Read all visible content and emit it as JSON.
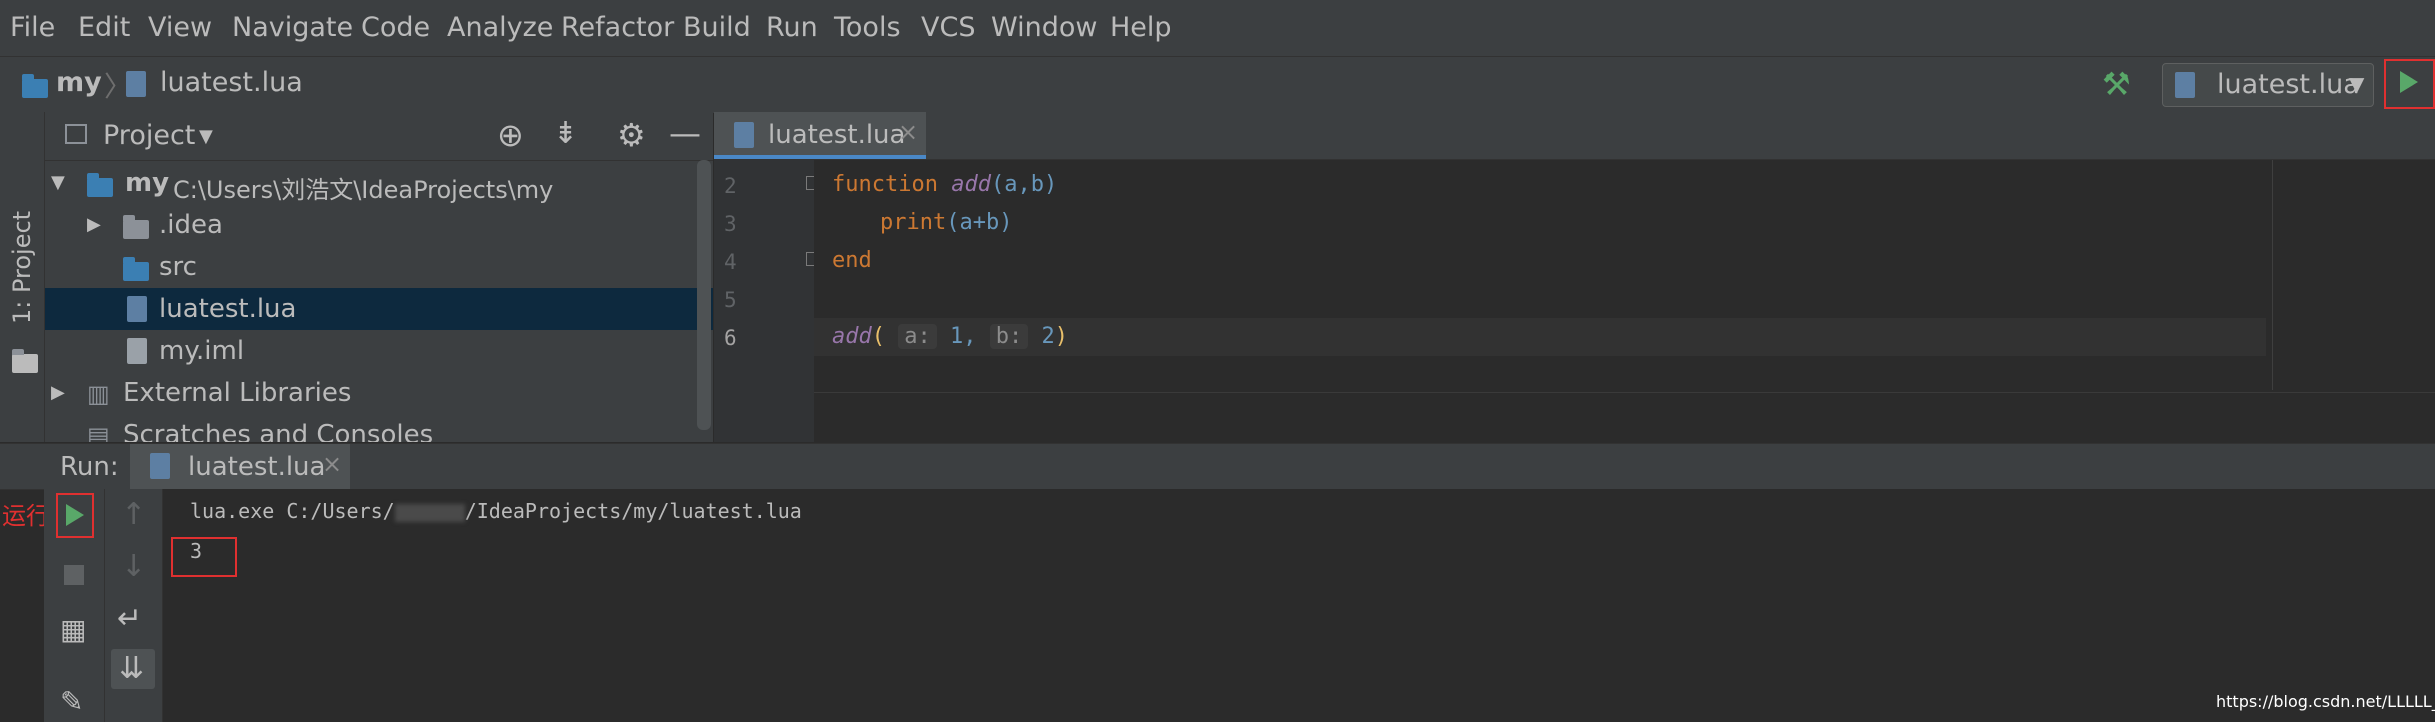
{
  "menu": [
    "File",
    "Edit",
    "View",
    "Navigate",
    "Code",
    "Analyze",
    "Refactor",
    "Build",
    "Run",
    "Tools",
    "VCS",
    "Window",
    "Help"
  ],
  "nav": {
    "project": "my",
    "file": "luatest.lua",
    "run_config": "luatest.lua"
  },
  "left_strip": {
    "project_tab": "1: Project"
  },
  "project_panel": {
    "title": "Project",
    "root_name": "my",
    "root_path": "C:\\Users\\刘浩文\\IdeaProjects\\my",
    "items": [
      ".idea",
      "src",
      "luatest.lua",
      "my.iml"
    ],
    "external": "External Libraries",
    "scratches": "Scratches and Consoles"
  },
  "editor": {
    "tab": "luatest.lua",
    "line_numbers": [
      "2",
      "3",
      "4",
      "5",
      "6"
    ],
    "code": {
      "l2_kw": "function",
      "l2_fn": "add",
      "l2_args": "(a,b)",
      "l3_call": "print",
      "l3_args": "(a+b)",
      "l4_kw": "end",
      "l6_fn": "add",
      "l6_open": "(",
      "l6_hint_a": "a:",
      "l6_val_a": "1,",
      "l6_hint_b": "b:",
      "l6_val_b": "2",
      "l6_close": ")"
    }
  },
  "run_panel": {
    "label": "Run:",
    "tab": "luatest.lua",
    "annotation": "运行",
    "command_prefix": "lua.exe C:/Users/",
    "command_suffix": "/IdeaProjects/my/luatest.lua",
    "output": "3"
  },
  "watermark": "https://blog.csdn.net/LLLLL__",
  "colors": {
    "accent_green": "#59a869",
    "highlight_red": "#e03030",
    "selection": "#0d293e",
    "tab_underline": "#4a88c7"
  }
}
